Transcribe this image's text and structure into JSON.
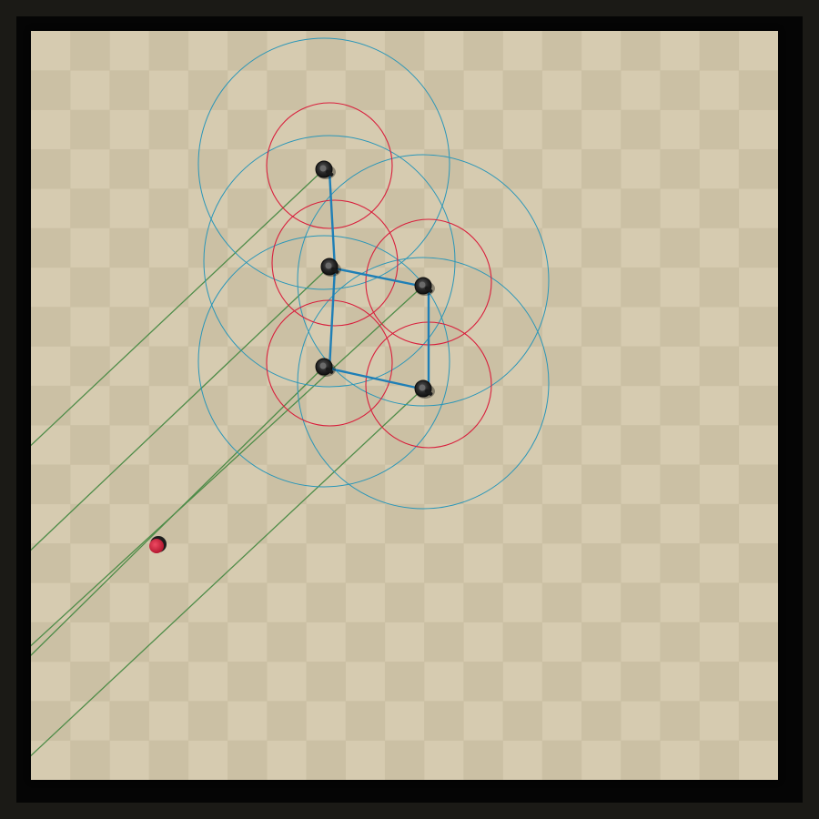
{
  "board": {
    "cols": 19,
    "rows": 19,
    "light_color": "#d6cbb0",
    "dark_color": "#cbc0a4"
  },
  "colors": {
    "frame": "#1b1a16",
    "inner_border": "#050505",
    "outer_range": "#2a96b8",
    "inner_range": "#d81e3c",
    "formation_link": "#1f7fb6",
    "sight_line": "#4e8c48",
    "unit": "#222222",
    "target": "#d22a44"
  },
  "units": [
    {
      "id": "unit-1",
      "type": "squad-member"
    },
    {
      "id": "unit-2",
      "type": "squad-member"
    },
    {
      "id": "unit-3",
      "type": "squad-member"
    },
    {
      "id": "unit-4",
      "type": "squad-member"
    },
    {
      "id": "unit-5",
      "type": "squad-member"
    }
  ],
  "target": {
    "id": "target-1",
    "type": "enemy"
  },
  "formation": {
    "links": [
      [
        "unit-1",
        "unit-2"
      ],
      [
        "unit-2",
        "unit-3"
      ],
      [
        "unit-2",
        "unit-4"
      ],
      [
        "unit-3",
        "unit-5"
      ],
      [
        "unit-4",
        "unit-5"
      ]
    ]
  }
}
